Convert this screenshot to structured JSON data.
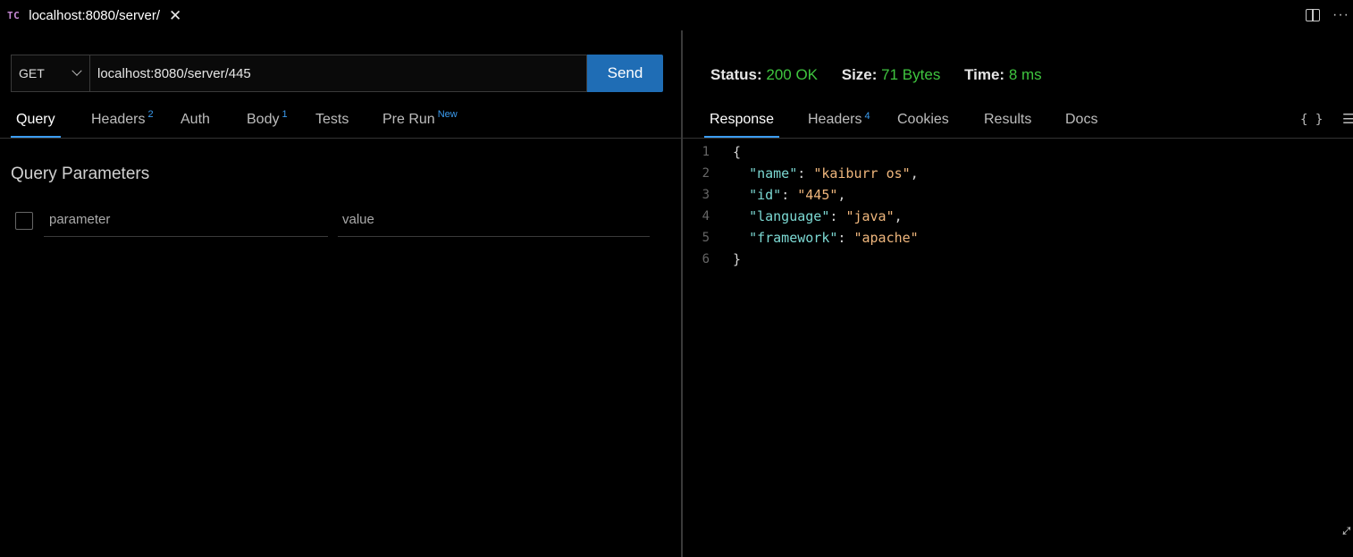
{
  "window": {
    "tab_logo": "TC",
    "tab_title": "localhost:8080/server/",
    "close_glyph": "✕",
    "actions": {
      "split_icon": "split-editor-icon",
      "more_glyph": "···"
    }
  },
  "request": {
    "method": "GET",
    "url": "localhost:8080/server/445",
    "send_label": "Send",
    "tabs": [
      {
        "label": "Query",
        "badge": ""
      },
      {
        "label": "Headers",
        "badge": "2"
      },
      {
        "label": "Auth",
        "badge": ""
      },
      {
        "label": "Body",
        "badge": "1"
      },
      {
        "label": "Tests",
        "badge": ""
      },
      {
        "label": "Pre Run",
        "badge": "New"
      }
    ],
    "active_tab": "Query",
    "query_title": "Query Parameters",
    "param_placeholder": "parameter",
    "value_placeholder": "value"
  },
  "response": {
    "status_label": "Status:",
    "status_value": "200 OK",
    "size_label": "Size:",
    "size_value": "71 Bytes",
    "time_label": "Time:",
    "time_value": "8 ms",
    "tabs": [
      {
        "label": "Response",
        "badge": ""
      },
      {
        "label": "Headers",
        "badge": "4"
      },
      {
        "label": "Cookies",
        "badge": ""
      },
      {
        "label": "Results",
        "badge": ""
      },
      {
        "label": "Docs",
        "badge": ""
      }
    ],
    "active_tab": "Response",
    "braces_glyph": "{ }",
    "menu_glyph": "☰",
    "line_numbers": [
      "1",
      "2",
      "3",
      "4",
      "5",
      "6"
    ],
    "body": {
      "open": "{",
      "fields": [
        {
          "key": "\"name\"",
          "value": "\"kaiburr os\"",
          "comma": ","
        },
        {
          "key": "\"id\"",
          "value": "\"445\"",
          "comma": ","
        },
        {
          "key": "\"language\"",
          "value": "\"java\"",
          "comma": ","
        },
        {
          "key": "\"framework\"",
          "value": "\"apache\"",
          "comma": ""
        }
      ],
      "close": "}"
    },
    "colors": {
      "status_ok": "#3fc53f",
      "accent": "#1f6db5",
      "json_key": "#7cd9d3",
      "json_string": "#f0b77d"
    }
  }
}
